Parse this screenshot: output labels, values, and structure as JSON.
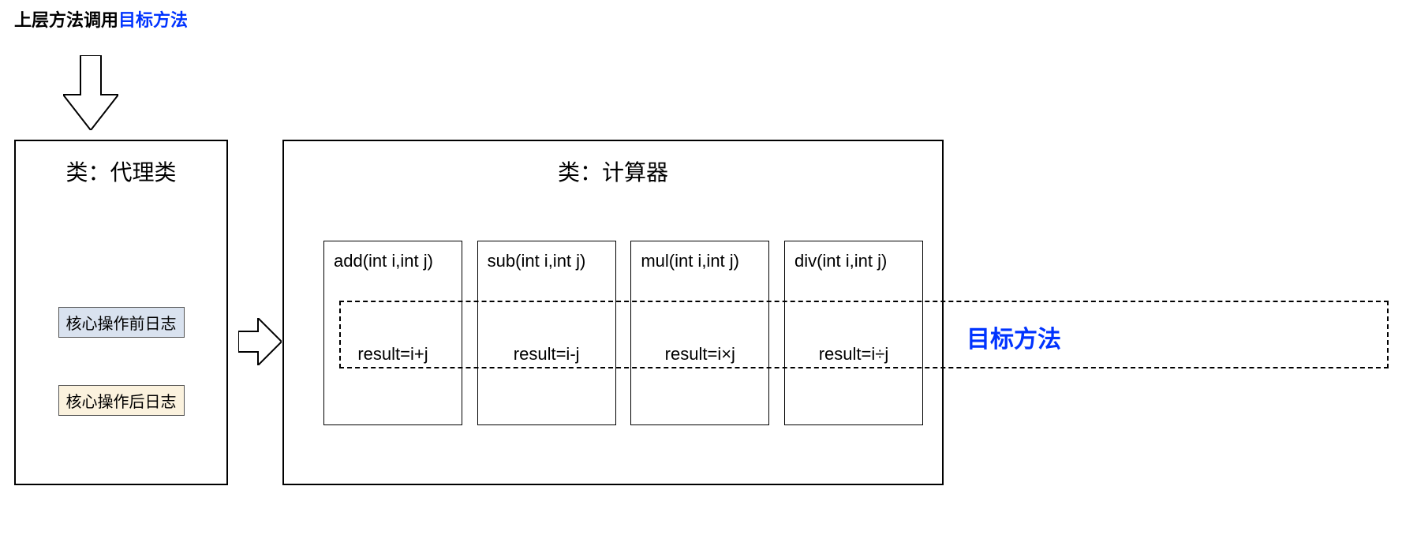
{
  "header": {
    "prefix": "上层方法调用",
    "highlight": "目标方法"
  },
  "proxy": {
    "title": "类：代理类",
    "log_before": "核心操作前日志",
    "log_after": "核心操作后日志"
  },
  "calculator": {
    "title": "类：计算器",
    "methods": [
      {
        "sig": "add(int i,int j)",
        "body": "result=i+j"
      },
      {
        "sig": "sub(int i,int j)",
        "body": "result=i-j"
      },
      {
        "sig": "mul(int i,int j)",
        "body": "result=i×j"
      },
      {
        "sig": "div(int i,int j)",
        "body": "result=i÷j"
      }
    ]
  },
  "target_label": "目标方法"
}
